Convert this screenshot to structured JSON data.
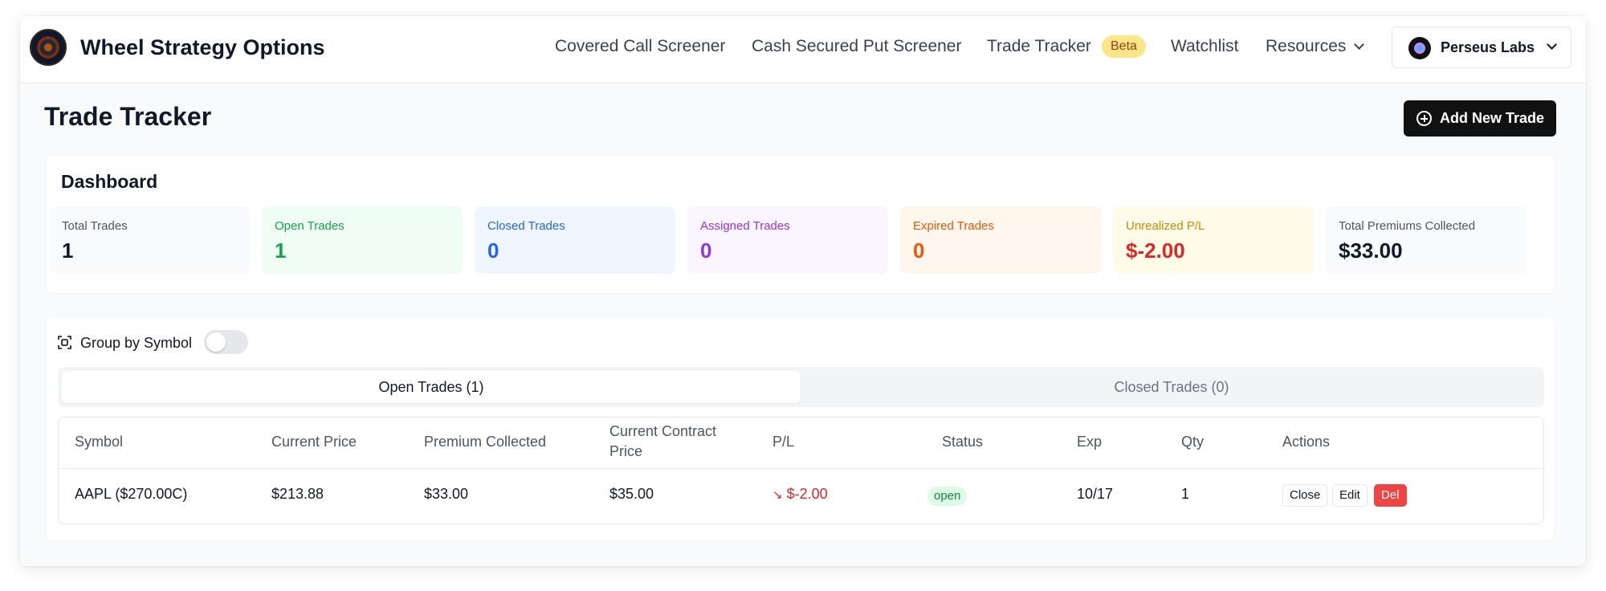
{
  "header": {
    "brand": "Wheel Strategy Options",
    "nav": {
      "covered_call": "Covered Call Screener",
      "cash_secured_put": "Cash Secured Put Screener",
      "trade_tracker": "Trade Tracker",
      "beta_badge": "Beta",
      "watchlist": "Watchlist",
      "resources": "Resources"
    },
    "account_name": "Perseus Labs"
  },
  "page": {
    "title": "Trade Tracker",
    "add_button": "Add New Trade"
  },
  "dashboard": {
    "title": "Dashboard",
    "stats": [
      {
        "label": "Total Trades",
        "value": "1"
      },
      {
        "label": "Open Trades",
        "value": "1"
      },
      {
        "label": "Closed Trades",
        "value": "0"
      },
      {
        "label": "Assigned Trades",
        "value": "0"
      },
      {
        "label": "Expired Trades",
        "value": "0"
      },
      {
        "label": "Unrealized P/L",
        "value": "$-2.00"
      },
      {
        "label": "Total Premiums Collected",
        "value": "$33.00"
      }
    ]
  },
  "trades": {
    "group_by_label": "Group by Symbol",
    "group_by_enabled": false,
    "tabs": {
      "open": "Open Trades (1)",
      "closed": "Closed Trades (0)"
    },
    "columns": [
      "Symbol",
      "Current Price",
      "Premium Collected",
      "Current Contract Price",
      "P/L",
      "Status",
      "Exp",
      "Qty",
      "Actions"
    ],
    "rows": [
      {
        "symbol": "AAPL ($270.00C)",
        "current_price": "$213.88",
        "premium_collected": "$33.00",
        "current_contract_price": "$35.00",
        "pl_arrow": "↘",
        "pl": "$-2.00",
        "status": "open",
        "exp": "10/17",
        "qty": "1",
        "actions": {
          "close": "Close",
          "edit": "Edit",
          "del": "Del"
        }
      }
    ]
  },
  "colors": {
    "accent_dark": "#111111",
    "beta_bg": "#fde68a",
    "negative": "#dc2626",
    "status_open_bg": "#dcfce7",
    "delete": "#ef4444"
  }
}
